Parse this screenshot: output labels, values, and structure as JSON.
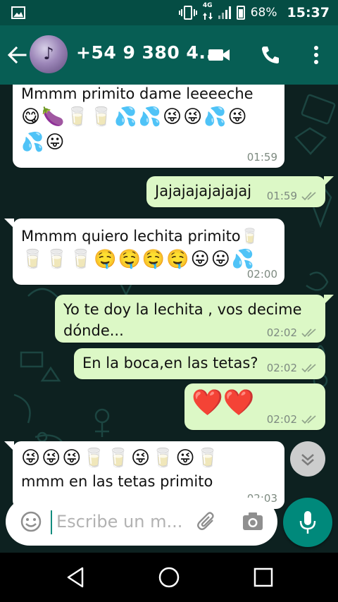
{
  "status_bar": {
    "network_type": "4G",
    "battery_percent": "68%",
    "time": "15:37"
  },
  "header": {
    "contact_name": "+54 9 380 4...",
    "icons": [
      "back-arrow-icon",
      "video-call-icon",
      "phone-icon",
      "more-vert-icon"
    ]
  },
  "messages": [
    {
      "direction": "in",
      "text": "Mmmm primito dame leeeeche",
      "emoji": "😋🍆🥛🥛💦💦😜😜💦😜💦😛",
      "time": "01:59"
    },
    {
      "direction": "out",
      "text": "Jajajajajajajaj",
      "time": "01:59",
      "status": "read"
    },
    {
      "direction": "in",
      "text": "Mmmm quiero lechita primito🥛",
      "emoji": "🥛🥛🥛🤤🤤🤤🤤😛😛💦",
      "time": "02:00"
    },
    {
      "direction": "out",
      "text": "Yo te doy la lechita , vos decime dónde...",
      "time": "02:02",
      "status": "read"
    },
    {
      "direction": "out",
      "text": "En la boca,en las tetas?",
      "time": "02:02",
      "status": "read"
    },
    {
      "direction": "out",
      "emoji": "❤️❤️",
      "time": "02:02",
      "status": "read"
    },
    {
      "direction": "in",
      "emoji": "😜😜😜🥛🥛😜🥛😜🥛",
      "text": "mmm en las tetas primito",
      "time": "02:03"
    }
  ],
  "composer": {
    "placeholder": "Escribe un m...",
    "icons": [
      "emoji-icon",
      "attach-clip-icon",
      "camera-icon",
      "microphone-icon"
    ]
  },
  "colors": {
    "status_bar": "#054d44",
    "toolbar": "#075e54",
    "outgoing_bubble": "#dcf8c6",
    "incoming_bubble": "#ffffff",
    "accent": "#00897b"
  }
}
